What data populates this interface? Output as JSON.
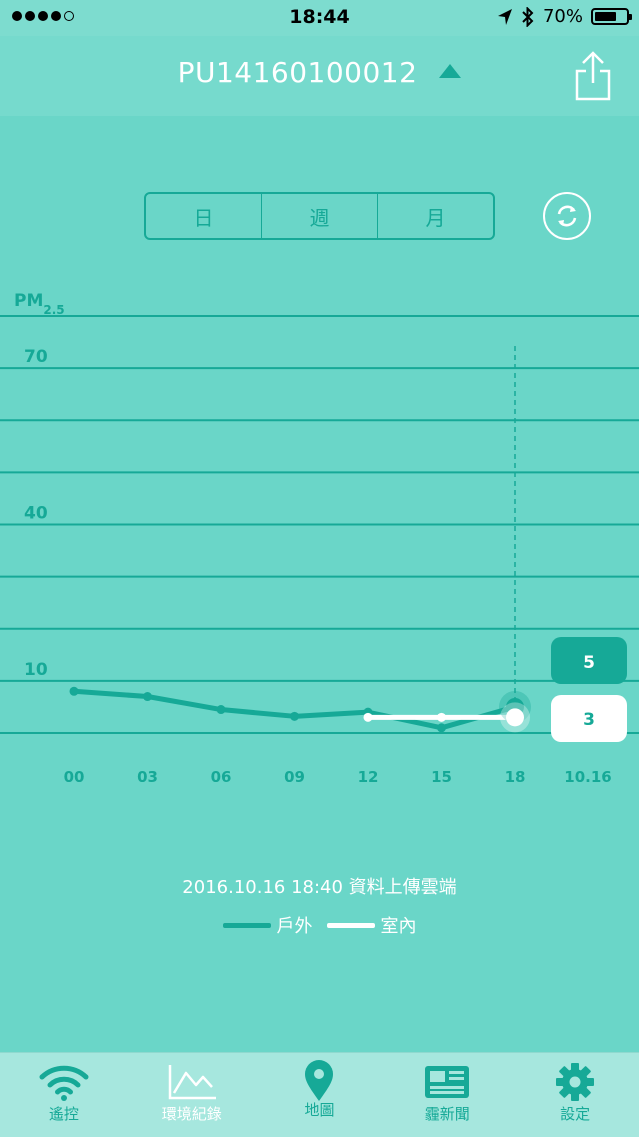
{
  "status_bar": {
    "time": "18:44",
    "battery": "70%",
    "battery_level": 0.7
  },
  "nav": {
    "title": "PU14160100012"
  },
  "range_tabs": [
    {
      "label": "日",
      "active": true
    },
    {
      "label": "週",
      "active": false
    },
    {
      "label": "月",
      "active": false
    }
  ],
  "colors": {
    "accent": "#16a997",
    "background": "#6ad6c8",
    "indoor": "#ffffff"
  },
  "chart_data": {
    "type": "line",
    "ylabel_main": "PM",
    "ylabel_sub": "2.5",
    "y_ticks": [
      "70",
      "40",
      "10"
    ],
    "x_tick_labels": [
      "00",
      "03",
      "06",
      "09",
      "12",
      "15",
      "18",
      "10.16"
    ],
    "ylim": [
      0,
      80
    ],
    "series": [
      {
        "name": "戶外",
        "color": "#16a997",
        "x": [
          0,
          3,
          6,
          9,
          12,
          15,
          18
        ],
        "values": [
          8,
          7,
          4.5,
          3.2,
          4,
          1,
          5
        ]
      },
      {
        "name": "室內",
        "color": "#ffffff",
        "x": [
          12,
          15,
          18
        ],
        "values": [
          3,
          3,
          3
        ]
      }
    ],
    "current": {
      "outdoor": "5",
      "indoor": "3"
    }
  },
  "footer": {
    "note": "2016.10.16 18:40 資料上傳雲端"
  },
  "tab_bar": [
    {
      "label": "遙控",
      "icon": "wifi-icon",
      "active": false
    },
    {
      "label": "環境紀錄",
      "icon": "line-chart-icon",
      "active": true
    },
    {
      "label": "地圖",
      "icon": "map-pin-icon",
      "active": false
    },
    {
      "label": "霾新聞",
      "icon": "newspaper-icon",
      "active": false
    },
    {
      "label": "設定",
      "icon": "gear-icon",
      "active": false
    }
  ]
}
